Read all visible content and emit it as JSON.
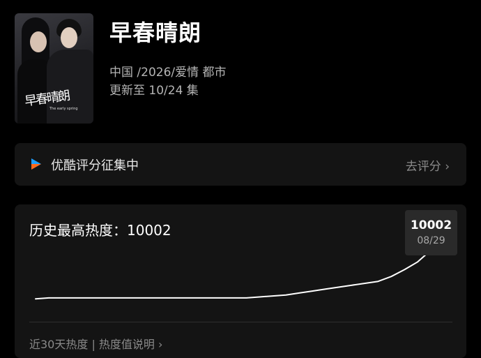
{
  "show": {
    "title": "早春晴朗",
    "meta": "中国 /2026/爱情 都市",
    "update": "更新至 10/24 集",
    "poster_title": "早春晴朗",
    "poster_subtitle": "The early spring"
  },
  "rating": {
    "icon": "youku-play-icon",
    "label": "优酷评分征集中",
    "link": "去评分 ›"
  },
  "heat": {
    "title": "历史最高热度：10002",
    "tooltip_value": "10002",
    "tooltip_date": "08/29",
    "footer": "近30天热度 | 热度值说明 ›"
  },
  "chart_data": {
    "type": "line",
    "series": [
      {
        "values": [
          9952,
          9953,
          9953,
          9953,
          9953,
          9953,
          9953,
          9953,
          9953,
          9953,
          9953,
          9953,
          9953,
          9953,
          9953,
          9953,
          9953,
          9954,
          9955,
          9956,
          9958,
          9960,
          9962,
          9964,
          9966,
          9968,
          9970,
          9975,
          9982,
          9990,
          10002
        ]
      }
    ],
    "ylim": [
      9945,
      10006
    ],
    "grid": false,
    "highlight": {
      "value": 10002,
      "label": "08/29"
    }
  },
  "colors": {
    "background": "#000000",
    "card": "#141414",
    "line": "#ffffff",
    "tooltip": "#2a2a2a",
    "youku_blue": "#1ea0ff",
    "youku_orange": "#ff6a1a"
  }
}
